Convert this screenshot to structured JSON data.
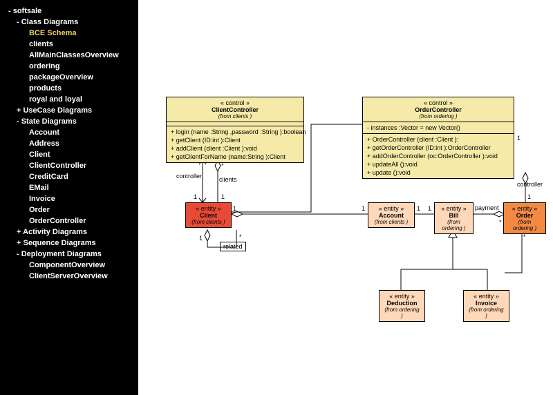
{
  "sidebar": {
    "root": "- softsale",
    "groups": [
      {
        "label": "- Class Diagrams",
        "items": [
          "BCE Schema",
          "clients",
          "AllMainClassesOverview",
          "ordering",
          "packageOverview",
          "products",
          "royal and loyal"
        ],
        "activeIndex": 0
      },
      {
        "label": "+ UseCase Diagrams",
        "items": []
      },
      {
        "label": "- State Diagrams",
        "items": [
          "Account",
          "Address",
          "Client",
          "ClientController",
          "CreditCard",
          "EMail",
          "Invoice",
          "Order",
          "OrderController"
        ]
      },
      {
        "label": "+ Activity Diagrams",
        "items": []
      },
      {
        "label": "+ Sequence Diagrams",
        "items": []
      },
      {
        "label": "- Deployment Diagrams",
        "items": [
          "ComponentOverview",
          "ClientServerOverview"
        ]
      }
    ]
  },
  "boxes": {
    "clientController": {
      "stereo": "«  control  »",
      "name": "ClientController",
      "from": "(from  clients )",
      "ops": [
        "+ login (name :String ,password :String ):boolean",
        "+ getClient (ID:int ):Client",
        "+ addClient (client :Client ):void",
        "+ getClientForName  (name:String ):Client"
      ]
    },
    "orderController": {
      "stereo": "«  control  »",
      "name": "OrderController",
      "from": "(from  ordering )",
      "attrs": [
        "- instances :Vector = new Vector()"
      ],
      "ops": [
        "+ OrderController  (client :Client ):",
        "+ getOrderController   (ID:int ):OrderController",
        "+ addOrderController   (oc:OrderController ):void",
        "+ updateAll ():void",
        "+ update ():void"
      ]
    },
    "client": {
      "stereo": "«  entity  »",
      "name": "Client",
      "from": "(from  clients )"
    },
    "account": {
      "stereo": "«  entity  »",
      "name": "Account",
      "from": "(from  clients )"
    },
    "bill": {
      "stereo": "«  entity  »",
      "name": "Bill",
      "from": "(from ordering )"
    },
    "order": {
      "stereo": "«  entity  »",
      "name": "Order",
      "from": "(from  ordering )"
    },
    "deduction": {
      "stereo": "«  entity  »",
      "name": "Deduction",
      "from": "(from  ordering )"
    },
    "invoice": {
      "stereo": "«  entity  »",
      "name": "Invoice",
      "from": "(from  ordering )"
    }
  },
  "labels": {
    "controller1": "controller",
    "controller2": "controller",
    "clients": "clients",
    "related": "related",
    "payment": "payment",
    "one_a": "1",
    "one_b": "1",
    "one_c": "1",
    "one_d": "1",
    "one_e": "1",
    "one_f": "1",
    "one_g": "1",
    "one_h": "1",
    "one_i": "1",
    "star_a": "*",
    "star_b": "*",
    "star_c": "*",
    "star_d": "*"
  }
}
